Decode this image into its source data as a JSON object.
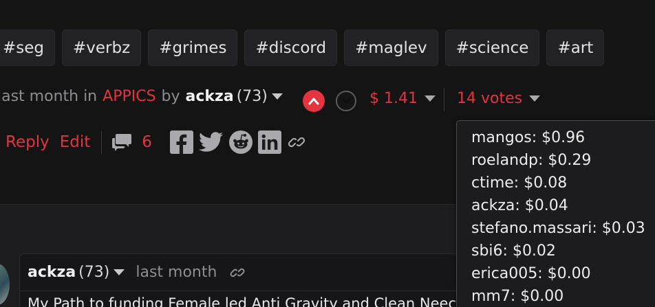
{
  "tags": [
    "#seg",
    "#verbz",
    "#grimes",
    "#discord",
    "#maglev",
    "#science",
    "#art"
  ],
  "post_meta": {
    "time_prefix": "last month in",
    "community": "APPICS",
    "by": "by",
    "author": "ackza",
    "reputation": "(73)"
  },
  "voting": {
    "payout": "$ 1.41",
    "votes_label": "14 votes"
  },
  "actions": {
    "reply": "Reply",
    "edit": "Edit",
    "comment_count": "6"
  },
  "voters": [
    "mangos: $0.96",
    "roelandp: $0.29",
    "ctime: $0.08",
    "ackza: $0.04",
    "stefano.massari: $0.03",
    "sbi6: $0.02",
    "erica005: $0.00",
    "mm7: $0.00"
  ],
  "comment": {
    "author": "ackza",
    "reputation": "(73)",
    "time": "last month",
    "title": "My Path to funding Female led Anti Gravity and Clean Neec"
  },
  "colors": {
    "accent": "#e3343f",
    "background": "#141415"
  },
  "icons": [
    "chevron-up-icon",
    "chevron-down-icon",
    "comments-icon",
    "facebook-icon",
    "twitter-icon",
    "reddit-icon",
    "linkedin-icon",
    "link-icon"
  ]
}
